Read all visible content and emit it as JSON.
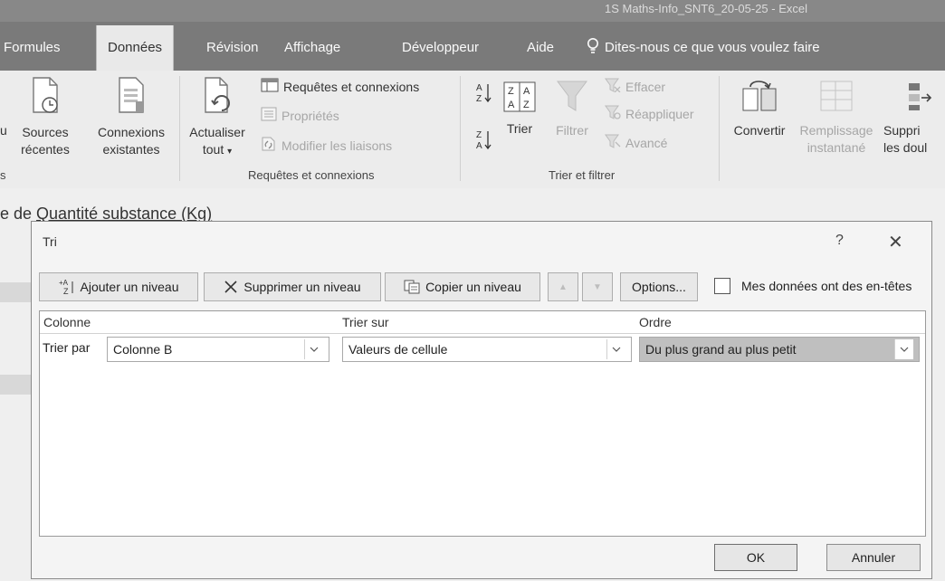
{
  "window": {
    "title": "1S Maths-Info_SNT6_20-05-25 - Excel"
  },
  "tabs": [
    "Formules",
    "Données",
    "Révision",
    "Affichage",
    "Développeur",
    "Aide"
  ],
  "active_tab": "Données",
  "tell_me": "Dites-nous ce que vous voulez faire",
  "ribbon": {
    "get_data": {
      "partial_left": "u",
      "recent_sources_line1": "Sources",
      "recent_sources_line2": "récentes",
      "existing_connections_line1": "Connexions",
      "existing_connections_line2": "existantes",
      "group_label_partial": "s"
    },
    "queries": {
      "refresh_line1": "Actualiser",
      "refresh_line2": "tout",
      "refresh_arrow": "▾",
      "queries_connections": "Requêtes et connexions",
      "properties": "Propriétés",
      "edit_links": "Modifier les liaisons",
      "group_label": "Requêtes et connexions"
    },
    "sort_filter": {
      "sort": "Trier",
      "filter": "Filtrer",
      "clear": "Effacer",
      "reapply": "Réappliquer",
      "advanced": "Avancé",
      "group_label": "Trier et filtrer"
    },
    "data_tools": {
      "convert": "Convertir",
      "flash_fill_line1": "Remplissage",
      "flash_fill_line2": "instantané",
      "remove_dup_line1": "Suppri",
      "remove_dup_line2": "les doul"
    }
  },
  "sheet": {
    "title_prefix": "e de ",
    "title_underlined": "Quantité substance (Kg)"
  },
  "dialog": {
    "title": "Tri",
    "help": "?",
    "close": "✕",
    "add_level": "Ajouter un niveau",
    "delete_level": "Supprimer un niveau",
    "copy_level": "Copier un niveau",
    "move_up": "▲",
    "move_down": "▼",
    "options": "Options...",
    "headers_checkbox_label": "Mes données ont des en-têtes",
    "headers_checked": false,
    "col_header": "Colonne",
    "sorton_header": "Trier sur",
    "order_header": "Ordre",
    "row": {
      "label": "Trier par",
      "column": "Colonne B",
      "sort_on": "Valeurs de cellule",
      "order": "Du plus grand au plus petit"
    },
    "ok": "OK",
    "cancel": "Annuler"
  },
  "colors": {
    "ribbon_tab_bar": "#7a7a7a",
    "selected_combo": "#bfbfbf"
  }
}
